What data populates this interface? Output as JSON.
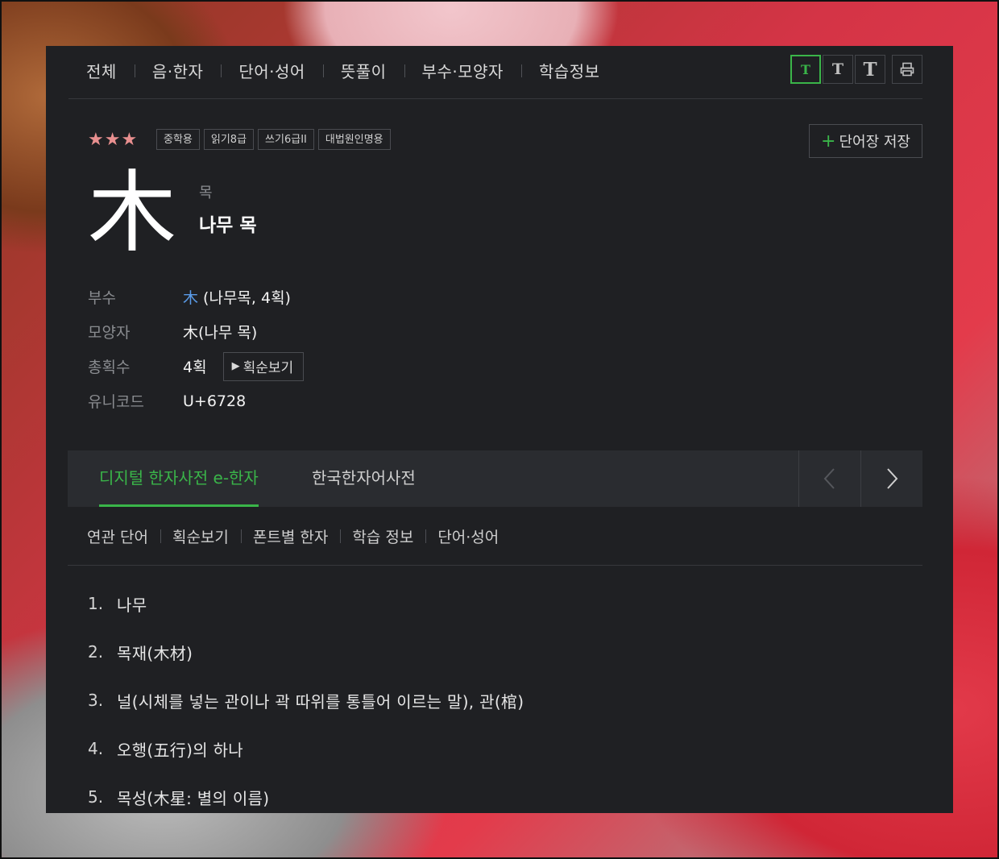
{
  "top_nav": [
    "전체",
    "음·한자",
    "단어·성어",
    "뜻풀이",
    "부수·모양자",
    "학습정보"
  ],
  "font_buttons": [
    "T",
    "T",
    "T"
  ],
  "print_icon": "print-icon",
  "stars": "★★★",
  "badges": [
    "중학용",
    "읽기8급",
    "쓰기6급II",
    "대법원인명용"
  ],
  "save_button": {
    "plus": "+",
    "label": "단어장 저장"
  },
  "hanja": {
    "char": "木",
    "reading_small": "목",
    "reading_main": "나무 목"
  },
  "info": {
    "radical_label": "부수",
    "radical_char": "木",
    "radical_desc": " (나무목, 4획)",
    "shape_label": "모양자",
    "shape_value": "木(나무 목)",
    "strokes_label": "총획수",
    "strokes_value": "4획",
    "stroke_button": "획순보기",
    "unicode_label": "유니코드",
    "unicode_value": "U+6728"
  },
  "source_tabs": {
    "active": "디지털 한자사전 e-한자",
    "inactive": "한국한자어사전"
  },
  "sub_nav": [
    "연관 단어",
    "획순보기",
    "폰트별 한자",
    "학습 정보",
    "단어·성어"
  ],
  "meanings": [
    {
      "num": "1.",
      "text": "나무"
    },
    {
      "num": "2.",
      "text": "목재(木材)"
    },
    {
      "num": "3.",
      "text": "널(시체를 넣는 관이나 곽 따위를 통틀어 이르는 말), 관(棺)"
    },
    {
      "num": "4.",
      "text": "오행(五行)의 하나"
    },
    {
      "num": "5.",
      "text": "목성(木星: 별의 이름)"
    }
  ],
  "colors": {
    "accent": "#3ab549",
    "link": "#5a9be8",
    "stars": "#e88f8f",
    "panel": "#1f2023"
  }
}
